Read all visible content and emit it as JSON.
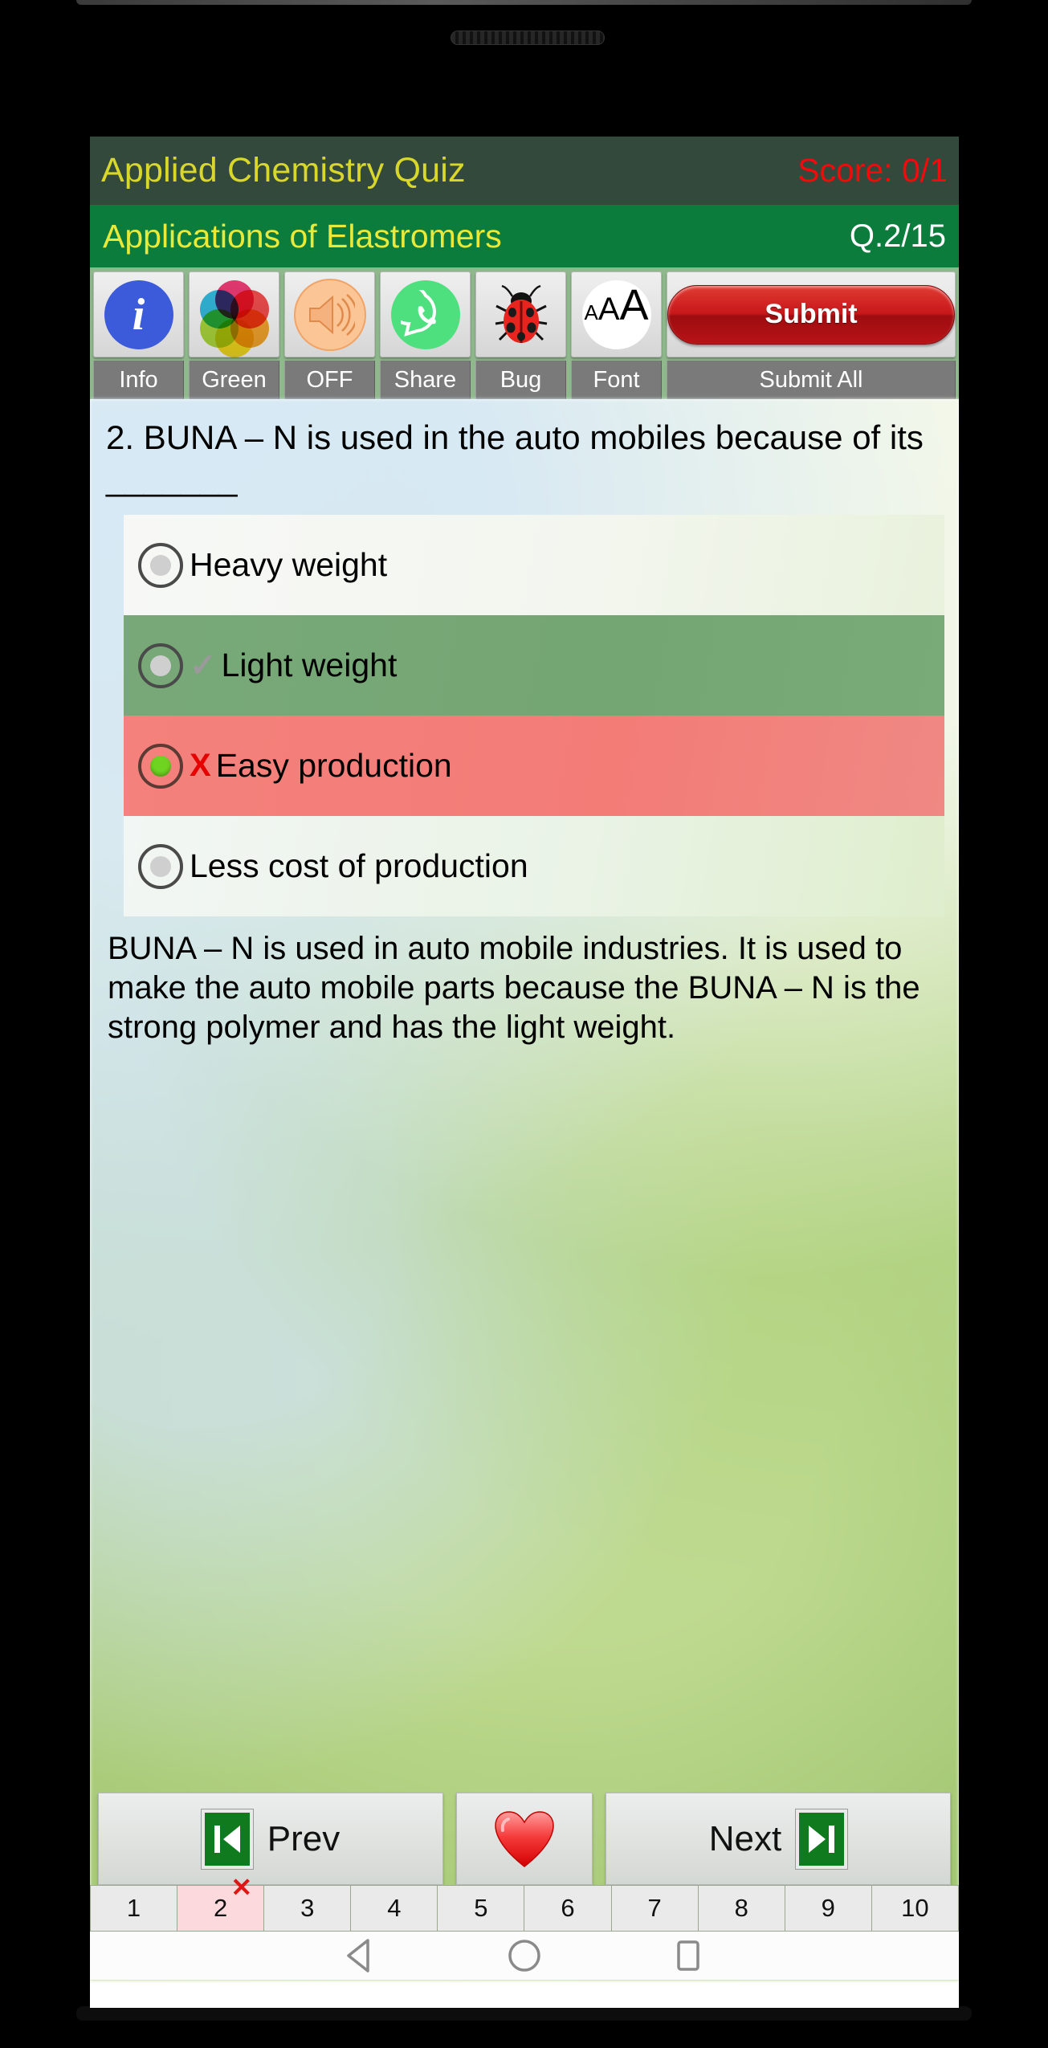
{
  "header": {
    "app_title": "Applied Chemistry Quiz",
    "score": "Score: 0/1",
    "title_bg": "#32493b",
    "title_color": "#d9d72b",
    "score_color": "#f40a0a"
  },
  "subheader": {
    "topic": "Applications of Elastromers",
    "question_index": "Q.2/15",
    "bg": "#0b7c3c",
    "topic_color": "#e9e93a",
    "index_color": "#ffffff"
  },
  "toolbar": {
    "items": [
      {
        "label": "Info",
        "icon": "info-icon"
      },
      {
        "label": "Green",
        "icon": "color-wheel-icon"
      },
      {
        "label": "OFF",
        "icon": "speaker-icon"
      },
      {
        "label": "Share",
        "icon": "whatsapp-icon"
      },
      {
        "label": "Bug",
        "icon": "ladybug-icon"
      },
      {
        "label": "Font",
        "icon": "font-size-icon"
      },
      {
        "label": "Submit All",
        "icon": "submit-button"
      }
    ],
    "submit_label": "Submit"
  },
  "question": {
    "text": "2. BUNA – N is used in the auto mobiles because of its _______",
    "options": [
      {
        "label": "Heavy weight",
        "state": "normal",
        "mark": "",
        "selected": false
      },
      {
        "label": "Light weight",
        "state": "correct",
        "mark": "✓",
        "selected": false
      },
      {
        "label": "Easy production",
        "state": "wrong",
        "mark": "X",
        "selected": true
      },
      {
        "label": "Less cost of production",
        "state": "normal",
        "mark": "",
        "selected": false
      }
    ],
    "explanation": "BUNA – N is used in auto mobile industries. It is used to make the auto mobile parts because the BUNA – N is the strong polymer and has the light weight."
  },
  "footer": {
    "prev_label": "Prev",
    "next_label": "Next",
    "favorite_icon": "heart-icon",
    "prev_icon": "skip-previous-icon",
    "next_icon": "skip-next-icon"
  },
  "pages": [
    {
      "number": "1",
      "state": "normal"
    },
    {
      "number": "2",
      "state": "wrong"
    },
    {
      "number": "3",
      "state": "normal"
    },
    {
      "number": "4",
      "state": "normal"
    },
    {
      "number": "5",
      "state": "normal"
    },
    {
      "number": "6",
      "state": "normal"
    },
    {
      "number": "7",
      "state": "normal"
    },
    {
      "number": "8",
      "state": "normal"
    },
    {
      "number": "9",
      "state": "normal"
    },
    {
      "number": "10",
      "state": "normal"
    }
  ],
  "page_mark": "✕",
  "android_nav": {
    "back": "back-icon",
    "home": "home-icon",
    "recents": "recents-icon"
  }
}
